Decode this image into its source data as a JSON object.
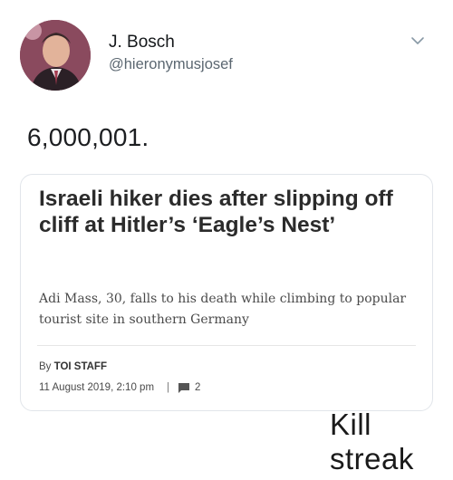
{
  "tweet": {
    "display_name": "J. Bosch",
    "handle": "@hieronymusjosef",
    "text": "6,000,001.",
    "avatar_icon": "profile-photo",
    "menu_icon": "chevron-down-icon"
  },
  "card": {
    "headline": "Israeli hiker dies after slipping off cliff at Hitler’s ‘Eagle’s Nest’",
    "summary": "Adi Mass, 30, falls to his death while climbing to popular tourist site in southern Germany",
    "byline_prefix": "By",
    "author": "TOI STAFF",
    "date": "11 August 2019, 2:10 pm",
    "separator": "|",
    "comment_count": "2"
  },
  "caption": "Kill streak",
  "colors": {
    "handle": "#5b6771",
    "border": "#e1e5ea"
  }
}
